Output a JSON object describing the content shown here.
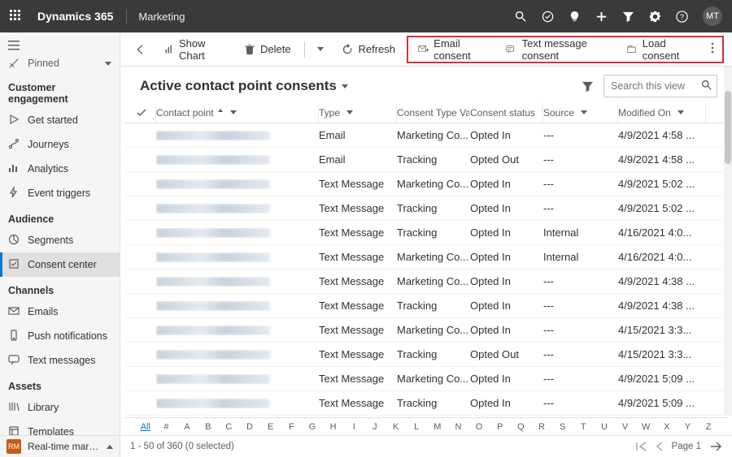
{
  "topbar": {
    "brand": "Dynamics 365",
    "module": "Marketing",
    "avatar": "MT"
  },
  "sidebar": {
    "pinned": "Pinned",
    "sections": [
      {
        "title": "Customer engagement",
        "items": [
          {
            "icon": "play-icon",
            "label": "Get started"
          },
          {
            "icon": "journeys-icon",
            "label": "Journeys"
          },
          {
            "icon": "analytics-icon",
            "label": "Analytics"
          },
          {
            "icon": "triggers-icon",
            "label": "Event triggers"
          }
        ]
      },
      {
        "title": "Audience",
        "items": [
          {
            "icon": "segments-icon",
            "label": "Segments"
          },
          {
            "icon": "consent-icon",
            "label": "Consent center",
            "active": true
          }
        ]
      },
      {
        "title": "Channels",
        "items": [
          {
            "icon": "email-icon",
            "label": "Emails"
          },
          {
            "icon": "push-icon",
            "label": "Push notifications"
          },
          {
            "icon": "sms-icon",
            "label": "Text messages"
          }
        ]
      },
      {
        "title": "Assets",
        "items": [
          {
            "icon": "library-icon",
            "label": "Library"
          },
          {
            "icon": "templates-icon",
            "label": "Templates"
          }
        ]
      }
    ]
  },
  "cmdbar": {
    "show_chart": "Show Chart",
    "delete": "Delete",
    "refresh": "Refresh",
    "email_consent": "Email consent",
    "text_consent": "Text message consent",
    "load_consent": "Load consent"
  },
  "view": {
    "title": "Active contact point consents",
    "search_placeholder": "Search this view"
  },
  "columns": {
    "contact_point": "Contact point",
    "type": "Type",
    "ctv": "Consent Type Va...",
    "status": "Consent status",
    "source": "Source",
    "modified": "Modified On"
  },
  "rows": [
    {
      "type": "Email",
      "ctv": "Marketing Co...",
      "status": "Opted In",
      "source": "---",
      "modified": "4/9/2021 4:58 ..."
    },
    {
      "type": "Email",
      "ctv": "Tracking",
      "status": "Opted Out",
      "source": "---",
      "modified": "4/9/2021 4:58 ..."
    },
    {
      "type": "Text Message",
      "ctv": "Marketing Co...",
      "status": "Opted In",
      "source": "---",
      "modified": "4/9/2021 5:02 ..."
    },
    {
      "type": "Text Message",
      "ctv": "Tracking",
      "status": "Opted In",
      "source": "---",
      "modified": "4/9/2021 5:02 ..."
    },
    {
      "type": "Text Message",
      "ctv": "Tracking",
      "status": "Opted In",
      "source": "Internal",
      "modified": "4/16/2021 4:0..."
    },
    {
      "type": "Text Message",
      "ctv": "Marketing Co...",
      "status": "Opted In",
      "source": "Internal",
      "modified": "4/16/2021 4:0..."
    },
    {
      "type": "Text Message",
      "ctv": "Marketing Co...",
      "status": "Opted In",
      "source": "---",
      "modified": "4/9/2021 4:38 ..."
    },
    {
      "type": "Text Message",
      "ctv": "Tracking",
      "status": "Opted In",
      "source": "---",
      "modified": "4/9/2021 4:38 ..."
    },
    {
      "type": "Text Message",
      "ctv": "Marketing Co...",
      "status": "Opted In",
      "source": "---",
      "modified": "4/15/2021 3:3..."
    },
    {
      "type": "Text Message",
      "ctv": "Tracking",
      "status": "Opted Out",
      "source": "---",
      "modified": "4/15/2021 3:3..."
    },
    {
      "type": "Text Message",
      "ctv": "Marketing Co...",
      "status": "Opted In",
      "source": "---",
      "modified": "4/9/2021 5:09 ..."
    },
    {
      "type": "Text Message",
      "ctv": "Tracking",
      "status": "Opted In",
      "source": "---",
      "modified": "4/9/2021 5:09 ..."
    }
  ],
  "alpha": [
    "All",
    "#",
    "A",
    "B",
    "C",
    "D",
    "E",
    "F",
    "G",
    "H",
    "I",
    "J",
    "K",
    "L",
    "M",
    "N",
    "O",
    "P",
    "Q",
    "R",
    "S",
    "T",
    "U",
    "V",
    "W",
    "X",
    "Y",
    "Z"
  ],
  "footer": {
    "area_badge": "RM",
    "area_label": "Real-time marketi...",
    "count": "1 - 50 of 360 (0 selected)",
    "page": "Page 1"
  }
}
